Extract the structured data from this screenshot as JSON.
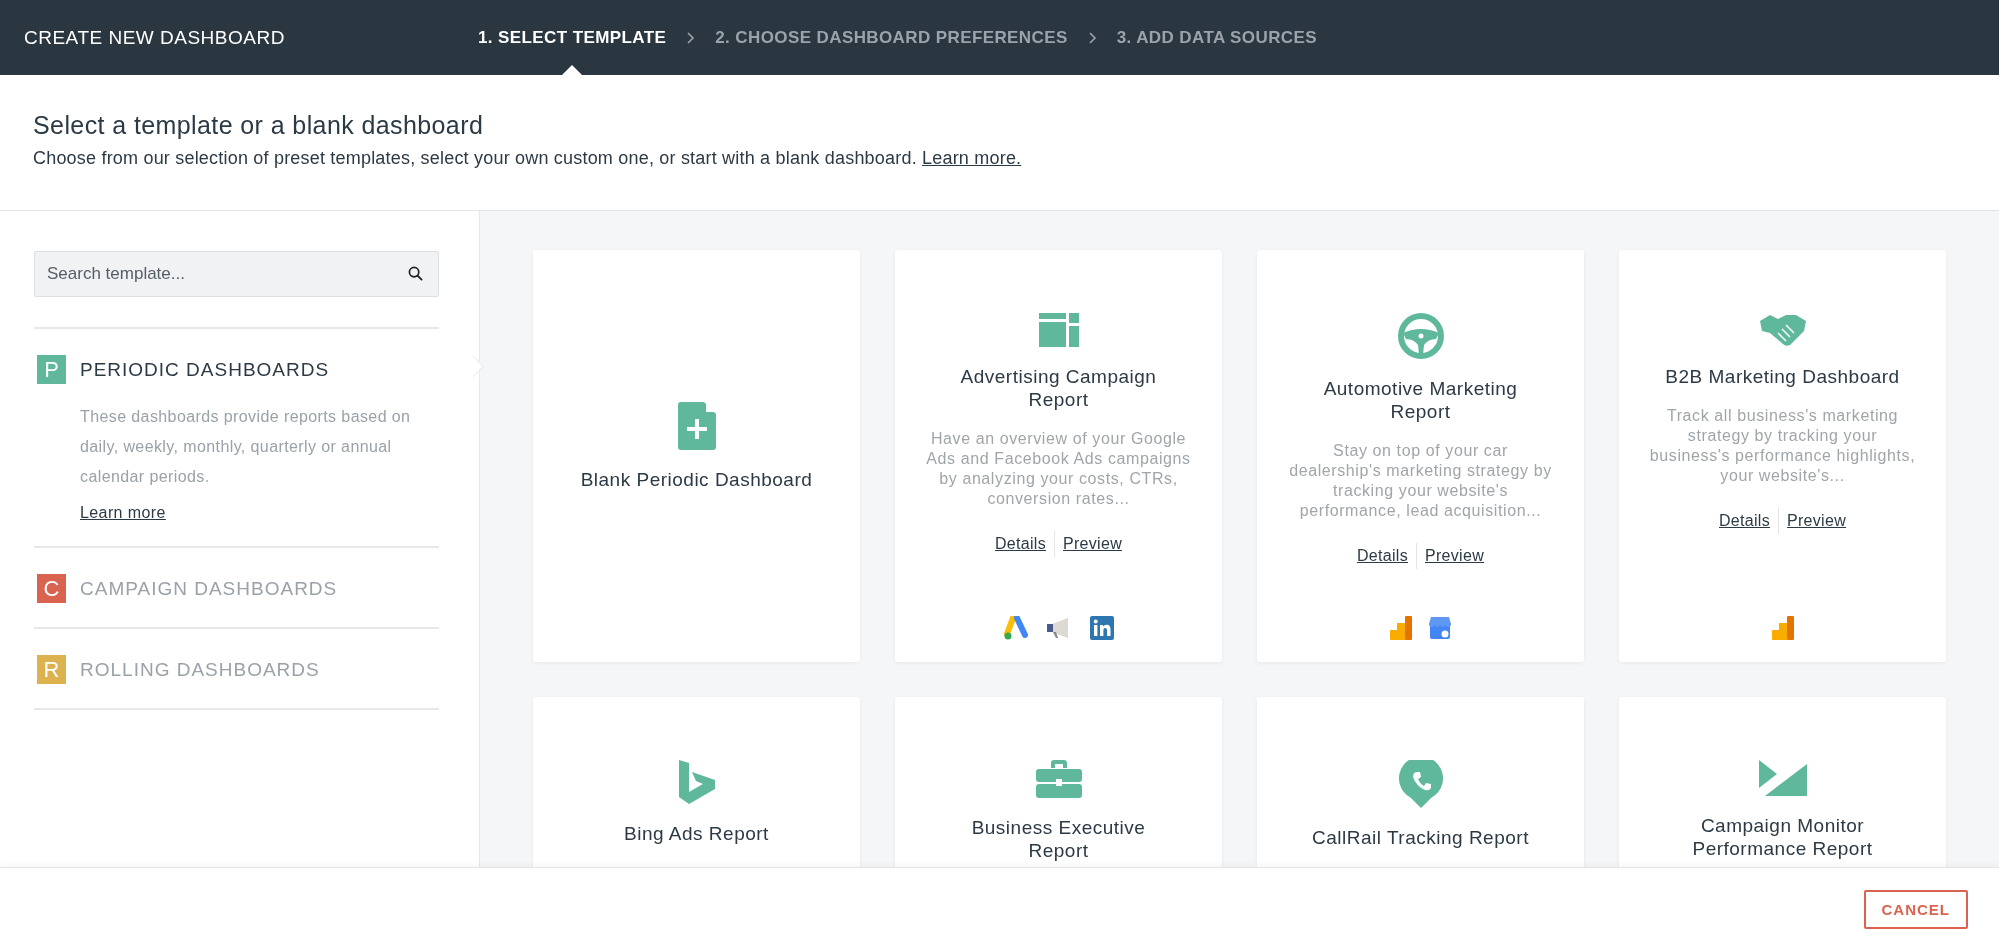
{
  "header": {
    "title": "CREATE NEW DASHBOARD",
    "steps": [
      {
        "label": "1. SELECT TEMPLATE",
        "selected": true
      },
      {
        "label": "2. CHOOSE DASHBOARD PREFERENCES",
        "selected": false
      },
      {
        "label": "3. ADD DATA SOURCES",
        "selected": false
      }
    ]
  },
  "intro": {
    "title": "Select a template or a blank dashboard",
    "text": "Choose from our selection of preset templates, select your own custom one, or start with a blank dashboard.",
    "link": "Learn more."
  },
  "sidebar": {
    "search": {
      "placeholder": "Search template..."
    },
    "categories": [
      {
        "letter": "P",
        "label": "PERIODIC DASHBOARDS",
        "color": "#5fb89c",
        "selected": true,
        "description": "These dashboards provide reports based on daily, weekly, monthly, quarterly or annual calendar periods.",
        "link": "Learn more"
      },
      {
        "letter": "C",
        "label": "CAMPAIGN DASHBOARDS",
        "color": "#d9634f",
        "selected": false
      },
      {
        "letter": "R",
        "label": "ROLLING DASHBOARDS",
        "color": "#dbb24f",
        "selected": false
      }
    ]
  },
  "templates": [
    {
      "kind": "blank",
      "title": "Blank Periodic Dashboard"
    },
    {
      "kind": "layout",
      "title": "Advertising Campaign Report",
      "description": "Have an overview of your Google Ads and Facebook Ads campaigns by analyzing your costs, CTRs, conversion rates...",
      "links": [
        "Details",
        "Preview"
      ],
      "sources": [
        {
          "kind": "google-ads"
        },
        {
          "kind": "megaphone"
        },
        {
          "kind": "linkedin"
        }
      ]
    },
    {
      "kind": "wheel",
      "title": "Automotive Marketing Report",
      "description": "Stay on top of your car dealership's marketing strategy by tracking your website's performance, lead acquisition...",
      "links": [
        "Details",
        "Preview"
      ],
      "sources": [
        {
          "kind": "analytics"
        },
        {
          "kind": "store"
        }
      ]
    },
    {
      "kind": "handshake",
      "title": "B2B Marketing Dashboard",
      "description": "Track all business's marketing strategy by tracking your business's performance highlights, your website's...",
      "links": [
        "Details",
        "Preview"
      ],
      "sources": [
        {
          "kind": "analytics"
        }
      ]
    },
    {
      "kind": "bing",
      "title": "Bing Ads Report"
    },
    {
      "kind": "briefcase",
      "title": "Business Executive Report"
    },
    {
      "kind": "phone-pin",
      "title": "CallRail Tracking Report"
    },
    {
      "kind": "envelope",
      "title": "Campaign Monitor Performance Report"
    }
  ],
  "footer": {
    "cancel": "CANCEL"
  }
}
